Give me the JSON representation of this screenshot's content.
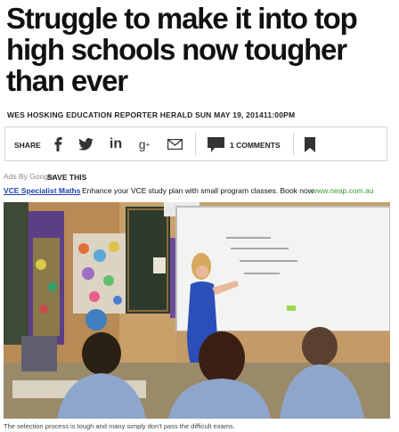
{
  "article": {
    "headline_lines": [
      "Struggle to make it into top",
      "high schools now tougher",
      "than ever"
    ],
    "byline": "WES HOSKING EDUCATION REPORTER  HERALD SUN  MAY 19, 201411:00PM"
  },
  "share_bar": {
    "share_label": "SHARE",
    "icons": [
      "facebook-icon",
      "twitter-icon",
      "linkedin-icon",
      "google-plus-icon",
      "email-icon"
    ],
    "comments_label": "1 COMMENTS"
  },
  "ad": {
    "ads_by": "Ads By Google",
    "save_label": "SAVE THIS",
    "link_text": "VCE Specialist Maths",
    "text": "Enhance your VCE study plan with small program classes. Book now",
    "url": "www.neap.com.au"
  },
  "photo": {
    "caption": "The selection process is tough and many simply don't pass the difficult exams.",
    "colors": {
      "wall": "#c9a06a",
      "whiteboard": "#f3f4f1",
      "dress": "#2b4fb8",
      "shirt": "#8fa6cc"
    }
  }
}
